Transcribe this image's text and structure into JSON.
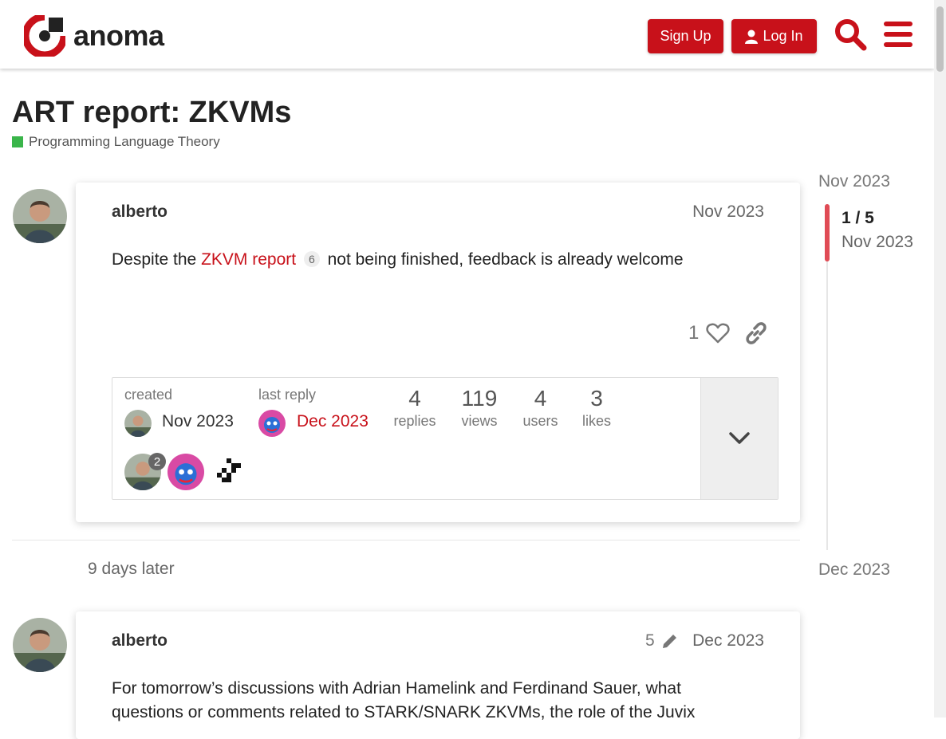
{
  "header": {
    "brand": "anoma",
    "signup_label": "Sign Up",
    "login_label": "Log In",
    "search_icon": "search-icon",
    "menu_icon": "hamburger-menu-icon",
    "accent_color": "#c8111a"
  },
  "topic": {
    "title": "ART report: ZKVMs",
    "category": "Programming Language Theory",
    "category_color": "#3ab54a"
  },
  "posts": [
    {
      "username": "alberto",
      "date": "Nov 2023",
      "body_prefix": "Despite the ",
      "link_text": "ZKVM report",
      "link_clicks": "6",
      "body_suffix": " not being finished, feedback is already welcome",
      "like_count": "1",
      "summary": {
        "created_label": "created",
        "created_date": "Nov 2023",
        "last_reply_label": "last reply",
        "last_reply_date": "Dec 2023",
        "stats": [
          {
            "value": "4",
            "label": "replies"
          },
          {
            "value": "119",
            "label": "views"
          },
          {
            "value": "4",
            "label": "users"
          },
          {
            "value": "3",
            "label": "likes"
          }
        ],
        "participant_badge": "2"
      }
    },
    {
      "username": "alberto",
      "edit_count": "5",
      "date": "Dec 2023",
      "body": "For tomorrow’s discussions with Adrian Hamelink and Ferdinand Sauer, what questions or comments related to STARK/SNARK ZKVMs, the role of the Juvix"
    }
  ],
  "time_gap": "9 days later",
  "timeline": {
    "start": "Nov 2023",
    "position": "1 / 5",
    "position_date": "Nov 2023",
    "end": "Dec 2023",
    "progress": 0.2
  }
}
